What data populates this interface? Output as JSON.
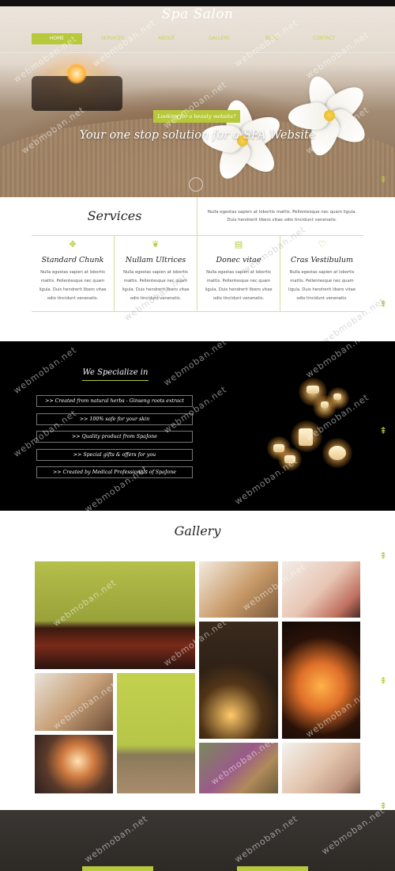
{
  "site": {
    "title": "Spa Salon"
  },
  "nav": {
    "items": [
      "HOME",
      "SERVICES",
      "ABOUT",
      "GALLERY",
      "BLOG",
      "CONTACT"
    ]
  },
  "hero": {
    "badge": "Looking for a beauty website?",
    "tagline": "Your one stop solution for a SPA Website"
  },
  "services": {
    "title": "Services",
    "intro": "Nulla egestas sapien at lobortis mattis. Pellentesque nec quam ligula. Duis hendrerit libero vitae odio tincidunt venenatis.",
    "items": [
      {
        "icon": "leaf-sprout-icon",
        "name": "Standard Chunk",
        "text": "Nulla egestas sapien at lobortis mattis. Pellentesque nec quam ligula. Duis hendrerit libero vitae odio tincidunt venenatis."
      },
      {
        "icon": "leaf-icon",
        "name": "Nullam Ultrices",
        "text": "Nulla egestas sapien at lobortis mattis. Pellentesque nec quam ligula. Duis hendrerit libero vitae odio tincidunt venenatis."
      },
      {
        "icon": "bed-icon",
        "name": "Donec vitae",
        "text": "Nulla egestas sapien at lobortis mattis. Pellentesque nec quam ligula. Duis hendrerit libero vitae odio tincidunt venenatis."
      },
      {
        "icon": "heart-icon",
        "name": "Cras Vestibulum",
        "text": "Nulla egestas sapien at lobortis mattis. Pellentesque nec quam ligula. Duis hendrerit libero vitae odio tincidunt venenatis."
      }
    ]
  },
  "specialize": {
    "title": "We Specialize in",
    "items": [
      ">> Created from natural herbs - Ginseng roots extract",
      ">> 100% safe for your skin",
      ">> Quality product from SpaJone",
      ">> Special gifts & offers for you",
      ">> Created by Medical Professionals of SpaJone"
    ]
  },
  "gallery": {
    "title": "Gallery"
  },
  "watermark": "webmoban.net",
  "colors": {
    "accent": "#b7c83a",
    "dark": "#000000"
  }
}
